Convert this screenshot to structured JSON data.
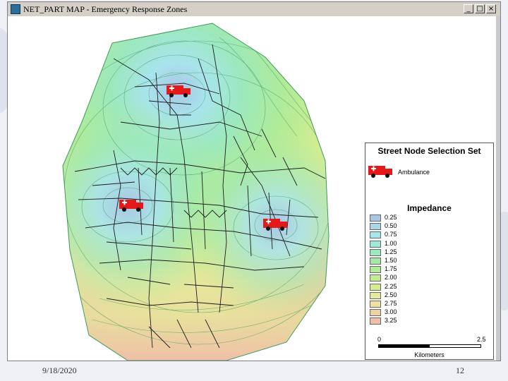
{
  "window": {
    "title": "NET_PART MAP - Emergency Response Zones",
    "buttons": {
      "minimize": "_",
      "maximize": "□",
      "close": "×"
    }
  },
  "map": {
    "ambulances": [
      {
        "id": "north",
        "position": "north"
      },
      {
        "id": "west",
        "position": "west"
      },
      {
        "id": "east",
        "position": "east"
      }
    ]
  },
  "legend": {
    "title": "Street Node Selection Set",
    "ambulance_label": "Ambulance",
    "impedance_title": "Impedance",
    "classes": [
      {
        "label": "0.25",
        "color": "#a9c6e4"
      },
      {
        "label": "0.50",
        "color": "#a9d6ea"
      },
      {
        "label": "0.75",
        "color": "#a8e4ec"
      },
      {
        "label": "1.00",
        "color": "#9fe8d8"
      },
      {
        "label": "1.25",
        "color": "#9ce8bd"
      },
      {
        "label": "1.50",
        "color": "#a4e8a6"
      },
      {
        "label": "1.75",
        "color": "#b0eb98"
      },
      {
        "label": "2.00",
        "color": "#c2ec93"
      },
      {
        "label": "2.25",
        "color": "#d5ec93"
      },
      {
        "label": "2.50",
        "color": "#e3eb98"
      },
      {
        "label": "2.75",
        "color": "#efe2a0"
      },
      {
        "label": "3.00",
        "color": "#f0d1a3"
      },
      {
        "label": "3.25",
        "color": "#f0bfa8"
      }
    ],
    "scale": {
      "start": "0",
      "end": "2.5",
      "unit": "Kilometers"
    }
  },
  "footer": {
    "date": "9/18/2020",
    "page": "12"
  }
}
